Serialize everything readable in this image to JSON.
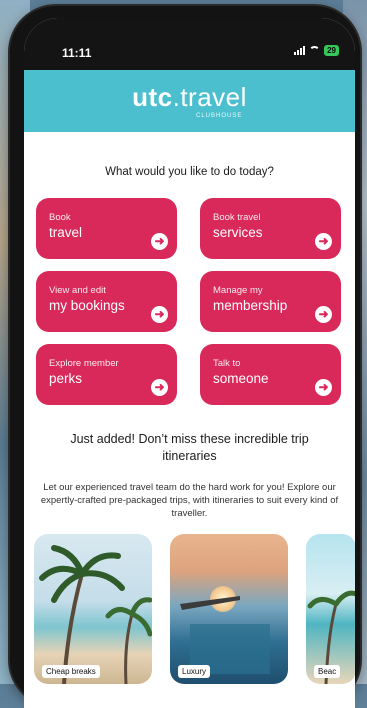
{
  "status": {
    "time": "11:11",
    "battery": "29"
  },
  "app": {
    "brand": "utc",
    "dot_word": ".travel",
    "sub": "CLUBHOUSE"
  },
  "question": "What would you like to do today?",
  "tiles": [
    {
      "small": "Book",
      "big": "travel",
      "icon": "arrow-right-circle-icon"
    },
    {
      "small": "Book travel",
      "big": "services",
      "icon": "arrow-right-circle-icon"
    },
    {
      "small": "View and edit",
      "big": "my bookings",
      "icon": "arrow-right-circle-icon"
    },
    {
      "small": "Manage my",
      "big": "membership",
      "icon": "arrow-right-circle-icon"
    },
    {
      "small": "Explore member",
      "big": "perks",
      "icon": "arrow-right-circle-icon"
    },
    {
      "small": "Talk to",
      "big": "someone",
      "icon": "arrow-right-circle-icon"
    }
  ],
  "just_added": "Just added! Don’t miss these incredible trip itineraries",
  "description": "Let our experienced travel team do the hard work for you! Explore our expertly-crafted pre-packaged trips, with itineraries to suit every kind of traveller.",
  "cards": [
    {
      "label": "Cheap breaks"
    },
    {
      "label": "Luxury"
    },
    {
      "label": "Beac"
    }
  ],
  "colors": {
    "header": "#4cbfcf",
    "tile": "#d8295a",
    "text": "#1c1c1c"
  }
}
